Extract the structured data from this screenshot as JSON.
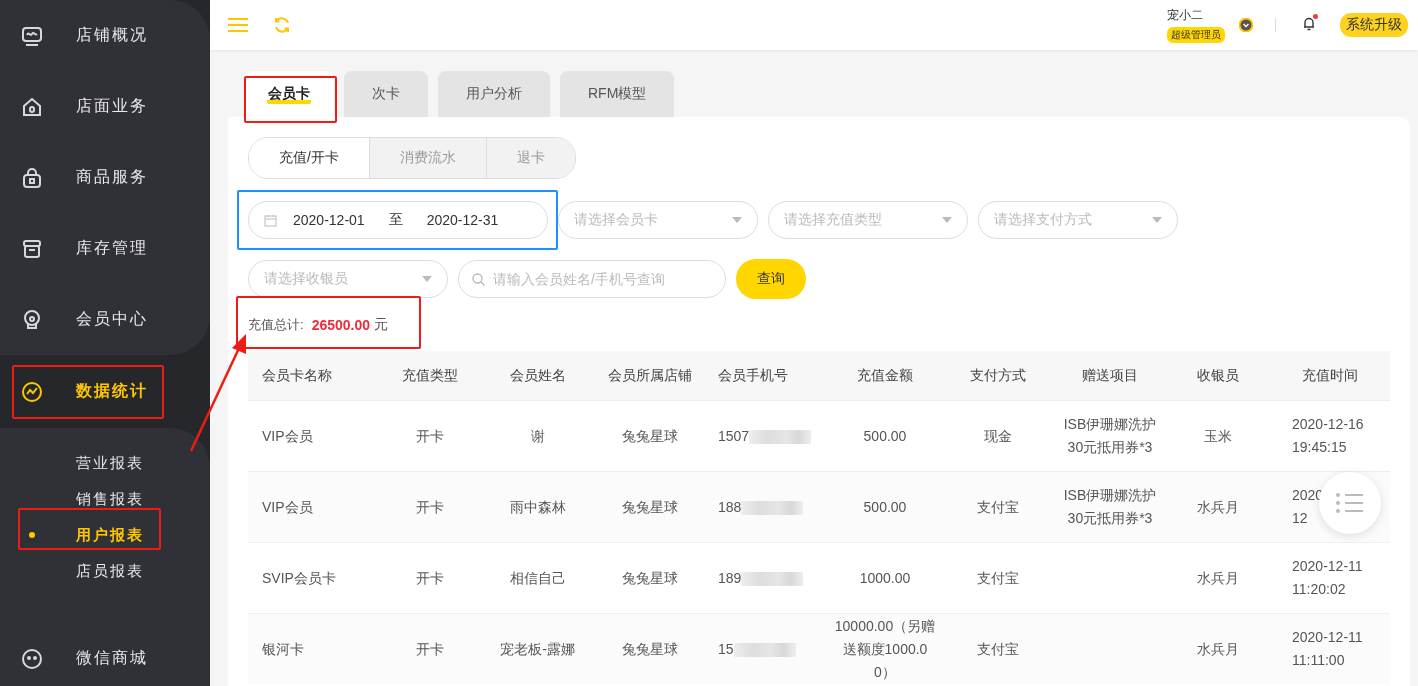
{
  "topbar": {
    "user_name": "宠小二",
    "role": "超级管理员",
    "notification_unread": true,
    "upgrade_button": "系统升级"
  },
  "sidebar": {
    "items": [
      {
        "label": "店铺概况",
        "selected": false
      },
      {
        "label": "店面业务",
        "selected": false
      },
      {
        "label": "商品服务",
        "selected": false
      },
      {
        "label": "库存管理",
        "selected": false
      },
      {
        "label": "会员中心",
        "selected": false
      },
      {
        "label": "数据统计",
        "selected": true,
        "children": [
          {
            "label": "营业报表",
            "selected": false
          },
          {
            "label": "销售报表",
            "selected": false
          },
          {
            "label": "用户报表",
            "selected": true
          },
          {
            "label": "店员报表",
            "selected": false
          }
        ]
      },
      {
        "label": "微信商城",
        "selected": false
      }
    ]
  },
  "tabs": [
    {
      "label": "会员卡",
      "selected": true
    },
    {
      "label": "次卡",
      "selected": false
    },
    {
      "label": "用户分析",
      "selected": false
    },
    {
      "label": "RFM模型",
      "selected": false
    }
  ],
  "subtabs": [
    {
      "label": "充值/开卡",
      "selected": true
    },
    {
      "label": "消费流水",
      "selected": false
    },
    {
      "label": "退卡",
      "selected": false
    }
  ],
  "filters": {
    "date_range": {
      "start": "2020-12-01",
      "separator": "至",
      "end": "2020-12-31"
    },
    "selects": [
      {
        "placeholder": "请选择会员卡"
      },
      {
        "placeholder": "请选择充值类型"
      },
      {
        "placeholder": "请选择支付方式"
      },
      {
        "placeholder": "请选择收银员"
      }
    ],
    "search": {
      "placeholder": "请输入会员姓名/手机号查询"
    },
    "query_button": "查询"
  },
  "total": {
    "label": "充值总计:",
    "value": "26500.00",
    "unit": "元"
  },
  "table": {
    "columns": [
      "会员卡名称",
      "充值类型",
      "会员姓名",
      "会员所属店铺",
      "会员手机号",
      "充值金额",
      "支付方式",
      "赠送项目",
      "收银员",
      "充值时间"
    ],
    "rows": [
      [
        "VIP会员",
        "开卡",
        "谢",
        "兔兔星球",
        "1507",
        "500.00",
        "现金",
        "ISB伊珊娜洗护30元抵用券*3",
        "玉米",
        "2020-12-16\n19:45:15"
      ],
      [
        "VIP会员",
        "开卡",
        "雨中森林",
        "兔兔星球",
        "188",
        "500.00",
        "支付宝",
        "ISB伊珊娜洗护30元抵用券*3",
        "水兵月",
        "2020\n12"
      ],
      [
        "SVIP会员卡",
        "开卡",
        "相信自己",
        "兔兔星球",
        "189",
        "1000.00",
        "支付宝",
        "",
        "水兵月",
        "2020-12-11\n11:20:02"
      ],
      [
        "银河卡",
        "开卡",
        "宠老板-露娜",
        "兔兔星球",
        "15",
        "10000.00（另赠送额度1000.00）",
        "支付宝",
        "",
        "水兵月",
        "2020-12-11\n11:11:00"
      ]
    ]
  }
}
